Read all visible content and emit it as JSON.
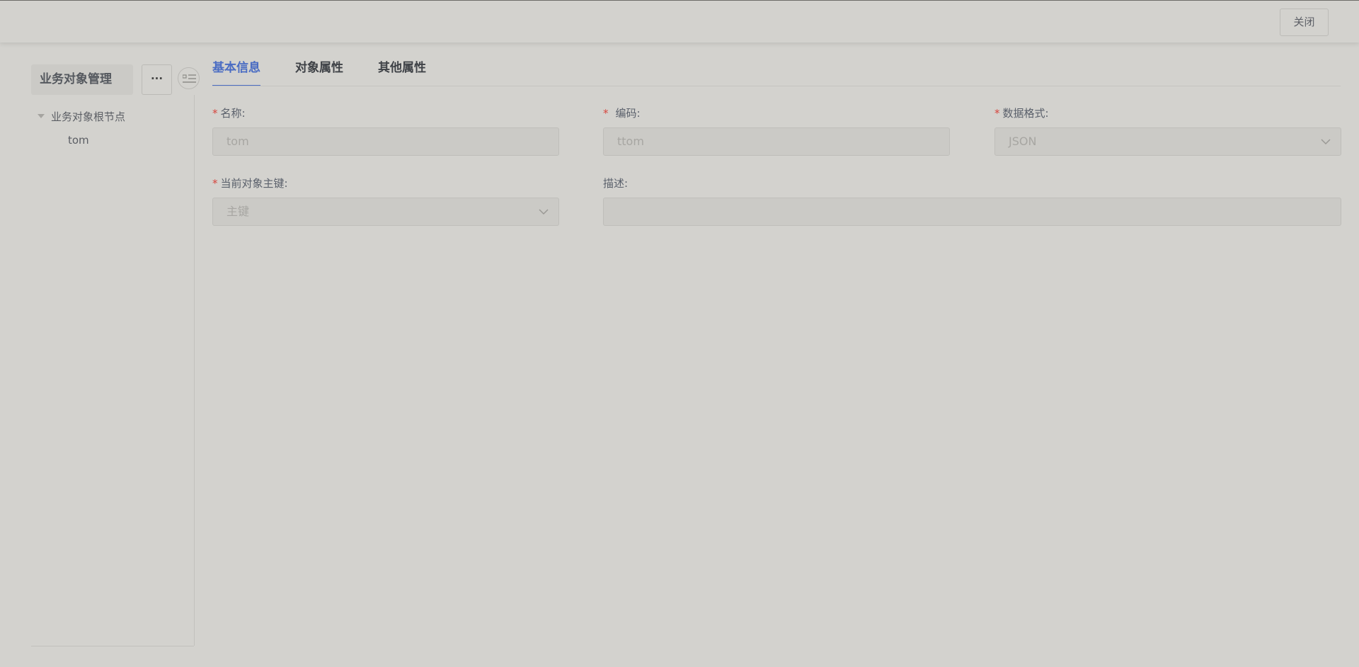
{
  "header": {
    "close_label": "关闭"
  },
  "sidebar": {
    "title": "业务对象管理",
    "more_label": "···",
    "tree": {
      "root_label": "业务对象根节点",
      "children": [
        "tom"
      ]
    }
  },
  "tabs": [
    {
      "label": "基本信息",
      "active": true
    },
    {
      "label": "对象属性",
      "active": false
    },
    {
      "label": "其他属性",
      "active": false
    }
  ],
  "form": {
    "name": {
      "label": "名称:",
      "required": "*",
      "value": "tom"
    },
    "code": {
      "label": "编码:",
      "required": "*",
      "value": "ttom"
    },
    "format": {
      "label": "数据格式:",
      "required": "*",
      "value": "JSON"
    },
    "primary_key": {
      "label": "当前对象主键:",
      "required": "*",
      "placeholder": "主键"
    },
    "description": {
      "label": "描述:",
      "value": ""
    }
  },
  "colors": {
    "accent": "#4a6cc3",
    "required": "#d6453d",
    "background": "#d3d2ce"
  }
}
